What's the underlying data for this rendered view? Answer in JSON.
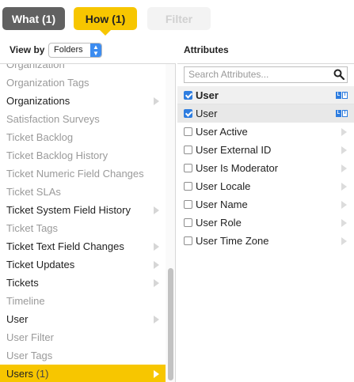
{
  "tabs": {
    "what": "What (1)",
    "how": "How (1)",
    "filter": "Filter"
  },
  "view_by": {
    "label": "View by",
    "selected": "Folders"
  },
  "attributes_header": "Attributes",
  "folders": [
    {
      "label": "Organization",
      "state": "dim",
      "has_arrow": false
    },
    {
      "label": "Organization Tags",
      "state": "dim",
      "has_arrow": false
    },
    {
      "label": "Organizations",
      "state": "normal",
      "has_arrow": true
    },
    {
      "label": "Satisfaction Surveys",
      "state": "dim",
      "has_arrow": false
    },
    {
      "label": "Ticket Backlog",
      "state": "dim",
      "has_arrow": false
    },
    {
      "label": "Ticket Backlog History",
      "state": "dim",
      "has_arrow": false
    },
    {
      "label": "Ticket Numeric Field Changes",
      "state": "dim",
      "has_arrow": false
    },
    {
      "label": "Ticket SLAs",
      "state": "dim",
      "has_arrow": false
    },
    {
      "label": "Ticket System Field History",
      "state": "normal",
      "has_arrow": true
    },
    {
      "label": "Ticket Tags",
      "state": "dim",
      "has_arrow": false
    },
    {
      "label": "Ticket Text Field Changes",
      "state": "normal",
      "has_arrow": true
    },
    {
      "label": "Ticket Updates",
      "state": "normal",
      "has_arrow": true
    },
    {
      "label": "Tickets",
      "state": "normal",
      "has_arrow": true
    },
    {
      "label": "Timeline",
      "state": "dim",
      "has_arrow": false
    },
    {
      "label": "User",
      "state": "normal",
      "has_arrow": true
    },
    {
      "label": "User Filter",
      "state": "dim",
      "has_arrow": false
    },
    {
      "label": "User Tags",
      "state": "dim",
      "has_arrow": false
    },
    {
      "label": "Users",
      "count": "(1)",
      "state": "selected",
      "has_arrow": true
    }
  ],
  "search": {
    "placeholder": "Search Attributes..."
  },
  "attribute_group": {
    "label": "User",
    "checked": true
  },
  "attributes": [
    {
      "label": "User",
      "checked": true,
      "highlight": true,
      "icon": "label-text-icon"
    },
    {
      "label": "User Active",
      "checked": false
    },
    {
      "label": "User External ID",
      "checked": false
    },
    {
      "label": "User Is Moderator",
      "checked": false
    },
    {
      "label": "User Locale",
      "checked": false
    },
    {
      "label": "User Name",
      "checked": false
    },
    {
      "label": "User Role",
      "checked": false
    },
    {
      "label": "User Time Zone",
      "checked": false
    }
  ],
  "colors": {
    "accent_yellow": "#f7c600",
    "tab_dark": "#616161",
    "checkbox_blue": "#2e7de0"
  }
}
